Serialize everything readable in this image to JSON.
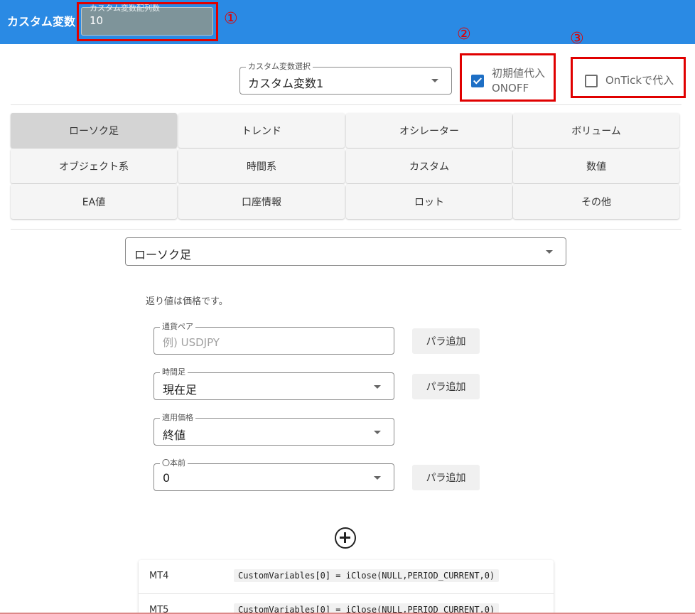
{
  "header": {
    "title": "カスタム変数",
    "array_count_label": "カスタム変数配列数",
    "array_count_value": "10",
    "background_color": "#2a8ae4"
  },
  "annotations": {
    "marker_1": "①",
    "marker_2": "②",
    "marker_3": "③",
    "color": "#e00000"
  },
  "variable_select": {
    "label": "カスタム変数選択",
    "value": "カスタム変数1"
  },
  "initial_value_checkbox": {
    "label_line1": "初期値代入",
    "label_line2": "ONOFF",
    "checked": true
  },
  "ontick_checkbox": {
    "label": "OnTickで代入",
    "checked": false
  },
  "categories": [
    {
      "label": "ローソク足",
      "active": true
    },
    {
      "label": "トレンド",
      "active": false
    },
    {
      "label": "オシレーター",
      "active": false
    },
    {
      "label": "ボリューム",
      "active": false
    },
    {
      "label": "オブジェクト系",
      "active": false
    },
    {
      "label": "時間系",
      "active": false
    },
    {
      "label": "カスタム",
      "active": false
    },
    {
      "label": "数値",
      "active": false
    },
    {
      "label": "EA値",
      "active": false
    },
    {
      "label": "口座情報",
      "active": false
    },
    {
      "label": "ロット",
      "active": false
    },
    {
      "label": "その他",
      "active": false
    }
  ],
  "function_select": {
    "value": "ローソク足"
  },
  "description": "返り値は価格です。",
  "params": {
    "currency_pair": {
      "label": "通貨ペア",
      "placeholder": "例) USDJPY"
    },
    "timeframe": {
      "label": "時間足",
      "value": "現在足"
    },
    "applied_price": {
      "label": "適用価格",
      "value": "終値"
    },
    "bars_ago": {
      "label": "〇本前",
      "value": "0"
    },
    "add_button_label": "パラ追加"
  },
  "code": {
    "mt4_label": "MT4",
    "mt4_code": "CustomVariables[0] = iClose(NULL,PERIOD_CURRENT,0)",
    "mt5_label": "MT5",
    "mt5_code": "CustomVariables[0] = iClose(NULL,PERIOD_CURRENT,0)"
  },
  "icons": {
    "add": "plus-circle-icon",
    "dropdown": "caret-down-icon",
    "check": "check-icon"
  }
}
